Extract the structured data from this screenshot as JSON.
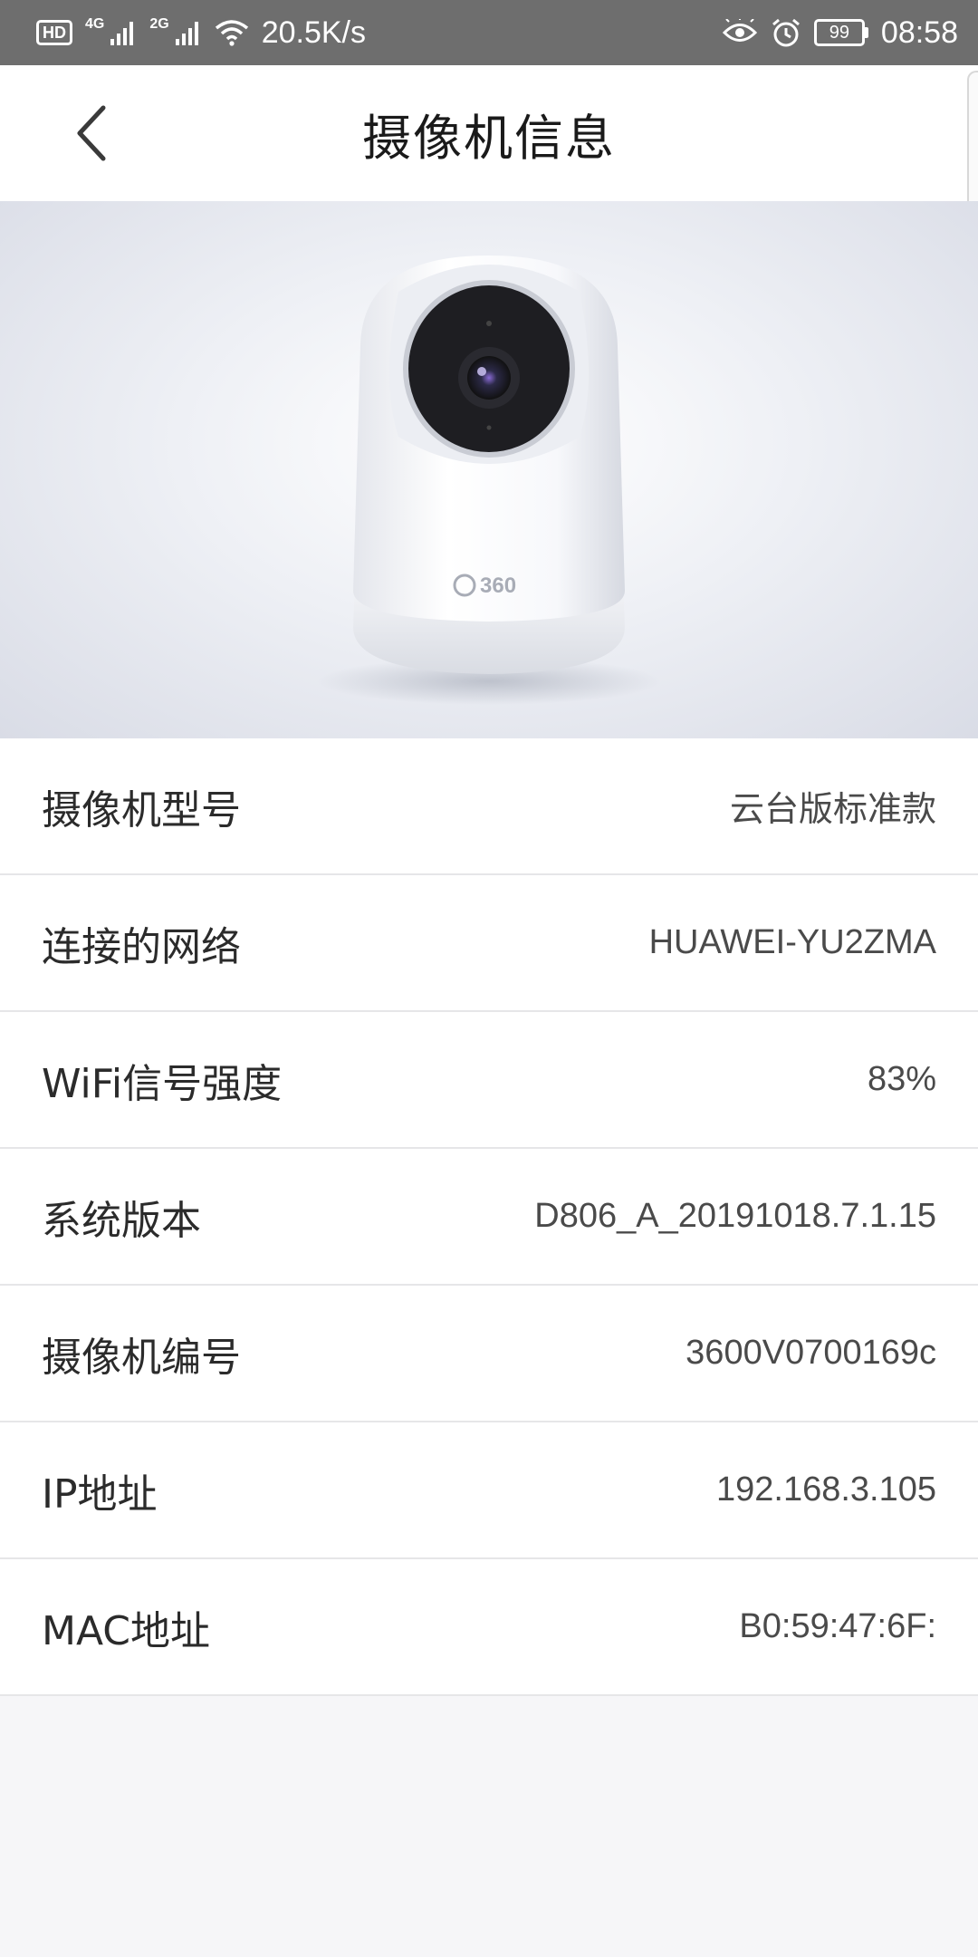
{
  "status_bar": {
    "hd": "HD",
    "sim1": "1",
    "net1": "4G",
    "net2": "2G",
    "speed": "20.5K/s",
    "battery": "99",
    "time": "08:58"
  },
  "header": {
    "title": "摄像机信息"
  },
  "hero": {
    "brand": "360"
  },
  "info": {
    "rows": [
      {
        "label": "摄像机型号",
        "value": "云台版标准款"
      },
      {
        "label": "连接的网络",
        "value": "HUAWEI-YU2ZMA"
      },
      {
        "label": "WiFi信号强度",
        "value": "83%"
      },
      {
        "label": "系统版本",
        "value": "D806_A_20191018.7.1.15"
      },
      {
        "label": "摄像机编号",
        "value": "3600V0700169c"
      },
      {
        "label": "IP地址",
        "value": "192.168.3.105"
      },
      {
        "label": "MAC地址",
        "value": "B0:59:47:6F:"
      }
    ]
  }
}
